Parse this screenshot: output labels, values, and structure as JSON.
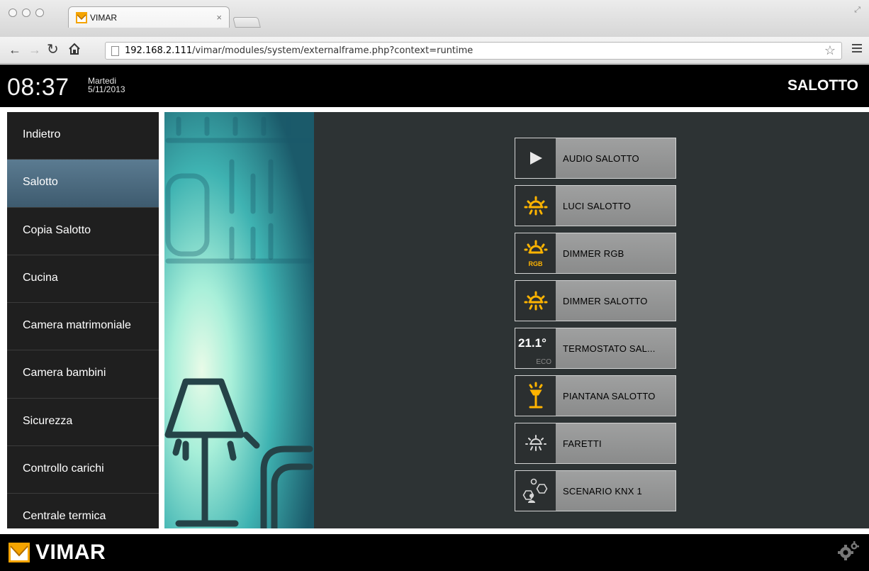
{
  "browser": {
    "tab_title": "VIMAR",
    "tab_close": "×",
    "url_host": "192.168.2.111",
    "url_path": "/vimar/modules/system/externalframe.php?context=runtime"
  },
  "header": {
    "time": "08:37",
    "weekday": "Martedi",
    "date": "5/11/2013",
    "room_title": "SALOTTO"
  },
  "sidebar": {
    "items": [
      {
        "label": "Indietro",
        "active": false
      },
      {
        "label": "Salotto",
        "active": true
      },
      {
        "label": "Copia Salotto",
        "active": false
      },
      {
        "label": "Cucina",
        "active": false
      },
      {
        "label": "Camera matrimoniale",
        "active": false
      },
      {
        "label": "Camera bambini",
        "active": false
      },
      {
        "label": "Sicurezza",
        "active": false
      },
      {
        "label": "Controllo carichi",
        "active": false
      },
      {
        "label": "Centrale termica",
        "active": false
      }
    ]
  },
  "devices": [
    {
      "label": "AUDIO SALOTTO",
      "icon": "play-icon"
    },
    {
      "label": "LUCI SALOTTO",
      "icon": "light-bulb-icon"
    },
    {
      "label": "DIMMER RGB",
      "icon": "rgb-dimmer-icon",
      "icon_text": "RGB"
    },
    {
      "label": "DIMMER SALOTTO",
      "icon": "light-bulb-icon"
    },
    {
      "label": "TERMOSTATO SAL...",
      "icon": "thermostat-icon",
      "temperature": "21.1°",
      "mode": "ECO"
    },
    {
      "label": "PIANTANA SALOTTO",
      "icon": "floor-lamp-icon"
    },
    {
      "label": "FARETTI",
      "icon": "light-bulb-off-icon"
    },
    {
      "label": "SCENARIO KNX 1",
      "icon": "scenario-icon"
    }
  ],
  "footer": {
    "brand": "VIMAR"
  },
  "colors": {
    "accent_on": "#ffb400",
    "active_item": "#4f6d82",
    "panel_bg": "#2d3334"
  }
}
